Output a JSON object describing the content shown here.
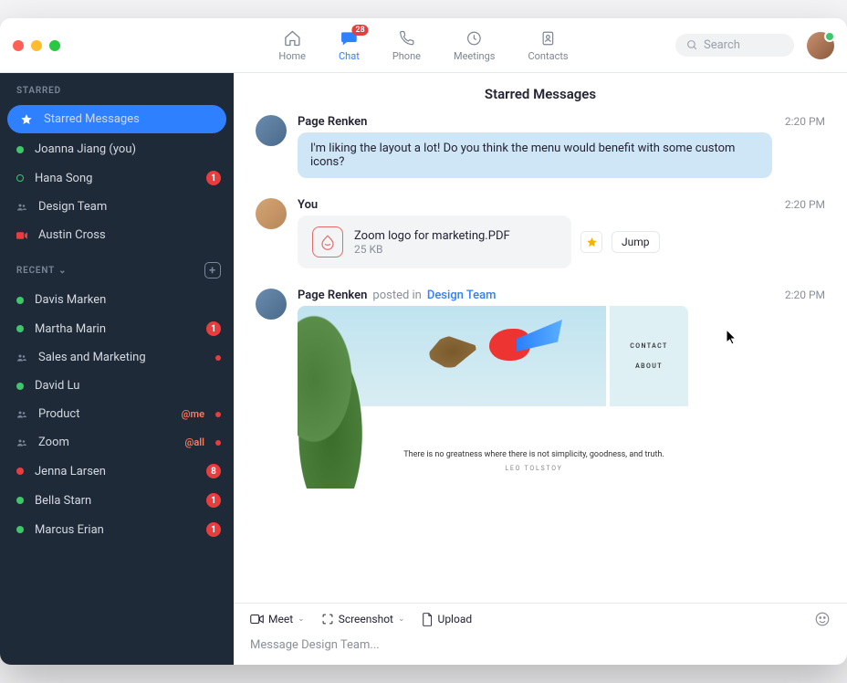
{
  "nav": {
    "home": "Home",
    "chat": "Chat",
    "chat_badge": "28",
    "phone": "Phone",
    "meetings": "Meetings",
    "contacts": "Contacts"
  },
  "search": {
    "placeholder": "Search"
  },
  "sidebar": {
    "starred_header": "STARRED",
    "recent_header": "RECENT",
    "starred": [
      {
        "label": "Starred Messages"
      },
      {
        "label": "Joanna Jiang (you)"
      },
      {
        "label": "Hana Song",
        "badge": "1"
      },
      {
        "label": "Design Team"
      },
      {
        "label": "Austin Cross"
      }
    ],
    "recent": [
      {
        "label": "Davis Marken"
      },
      {
        "label": "Martha Marin",
        "badge": "1"
      },
      {
        "label": "Sales and Marketing"
      },
      {
        "label": "David Lu"
      },
      {
        "label": "Product",
        "mention": "@me"
      },
      {
        "label": "Zoom",
        "mention": "@all"
      },
      {
        "label": "Jenna Larsen",
        "badge": "8"
      },
      {
        "label": "Bella Starn",
        "badge": "1"
      },
      {
        "label": "Marcus Erian",
        "badge": "1"
      }
    ]
  },
  "main": {
    "title": "Starred Messages",
    "messages": [
      {
        "author": "Page Renken",
        "time": "2:20 PM",
        "text": "I'm liking the layout a lot! Do you think the menu would benefit with some custom icons?"
      },
      {
        "author": "You",
        "time": "2:20 PM",
        "file": {
          "name": "Zoom logo for marketing.PDF",
          "size": "25 KB"
        },
        "jump": "Jump"
      },
      {
        "author": "Page Renken",
        "posted_in_label": "posted in",
        "channel": "Design Team",
        "time": "2:20 PM",
        "card": {
          "contact": "CONTACT",
          "about": "ABOUT",
          "quote": "There is no greatness where there is not simplicity, goodness, and truth.",
          "attribution": "LEO TOLSTOY"
        }
      }
    ]
  },
  "composer": {
    "meet": "Meet",
    "screenshot": "Screenshot",
    "upload": "Upload",
    "placeholder": "Message Design Team..."
  }
}
